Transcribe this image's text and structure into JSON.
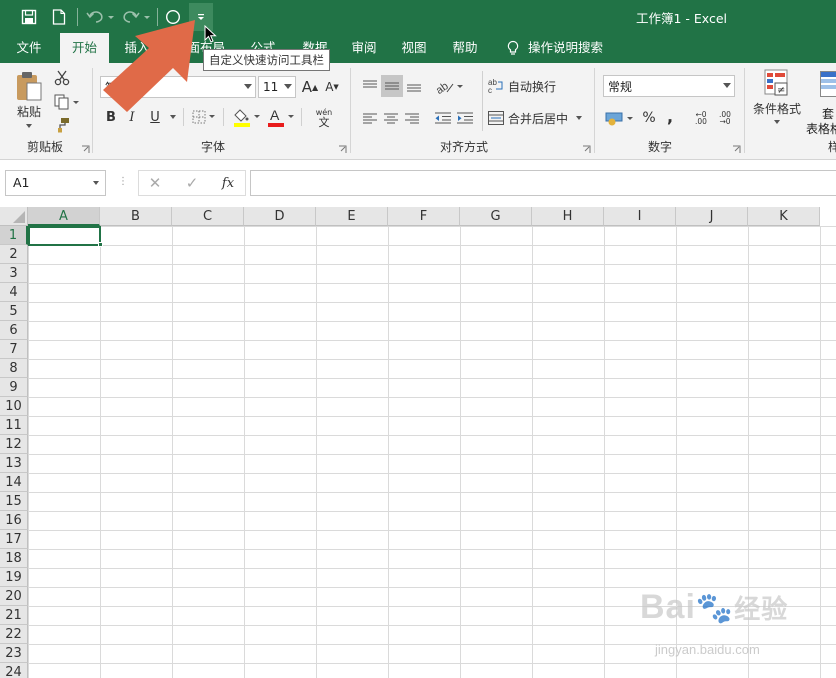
{
  "window": {
    "title": "工作簿1 - Excel"
  },
  "quick_access": {
    "tooltip": "自定义快速访问工具栏"
  },
  "tabs": [
    {
      "label": "文件",
      "active": false
    },
    {
      "label": "开始",
      "active": true
    },
    {
      "label": "插入",
      "active": false
    },
    {
      "label": "页面布局",
      "active": false
    },
    {
      "label": "公式",
      "active": false
    },
    {
      "label": "数据",
      "active": false
    },
    {
      "label": "审阅",
      "active": false
    },
    {
      "label": "视图",
      "active": false
    },
    {
      "label": "帮助",
      "active": false
    }
  ],
  "tell_me": "操作说明搜索",
  "ribbon": {
    "clipboard": {
      "paste_label": "粘贴",
      "group_label": "剪贴板"
    },
    "font": {
      "font_name": "等线",
      "font_size": "11",
      "bold": "B",
      "italic": "I",
      "underline": "U",
      "phonetic_top": "wén",
      "phonetic_bottom": "文",
      "group_label": "字体",
      "grow": "A",
      "shrink": "A"
    },
    "alignment": {
      "wrap_text": "自动换行",
      "merge_center": "合并后居中",
      "group_label": "对齐方式"
    },
    "number": {
      "format": "常规",
      "percent": "%",
      "comma": ",",
      "inc_decimal_top": "←0",
      "inc_decimal_bottom": ".00",
      "dec_decimal_top": ".00",
      "dec_decimal_bottom": "→0",
      "group_label": "数字"
    },
    "styles": {
      "conditional_format": "条件格式",
      "table_format_top": "套",
      "table_format_bottom": "表格格",
      "group_label_partial": "样"
    }
  },
  "formula_bar": {
    "name_box": "A1",
    "fx": "fx",
    "value": ""
  },
  "grid": {
    "columns": [
      "A",
      "B",
      "C",
      "D",
      "E",
      "F",
      "G",
      "H",
      "I",
      "J",
      "K"
    ],
    "rows": [
      "1",
      "2",
      "3",
      "4",
      "5",
      "6",
      "7",
      "8",
      "9",
      "10",
      "11",
      "12",
      "13",
      "14",
      "15",
      "16",
      "17",
      "18",
      "19",
      "20",
      "21",
      "22",
      "23",
      "24"
    ],
    "selected_cell": "A1"
  },
  "watermark": {
    "brand": "Bai",
    "brand2": "经验",
    "url": "jingyan.baidu.com"
  },
  "colors": {
    "accent": "#217346",
    "arrow": "#e06a48"
  }
}
